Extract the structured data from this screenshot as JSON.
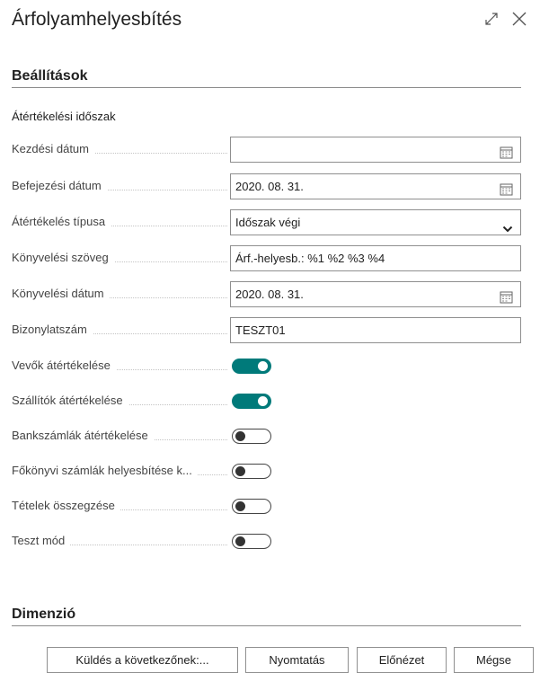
{
  "dialog": {
    "title": "Árfolyamhelyesbítés"
  },
  "sections": {
    "options_title": "Beállítások",
    "group_title": "Átértékelési időszak",
    "dimension_title": "Dimenzió"
  },
  "fields": {
    "start_date_label": "Kezdési dátum",
    "start_date_value": "",
    "end_date_label": "Befejezési dátum",
    "end_date_value": "2020. 08. 31.",
    "reval_type_label": "Átértékelés típusa",
    "reval_type_value": "Időszak végi",
    "posting_text_label": "Könyvelési szöveg",
    "posting_text_value": "Árf.-helyesb.: %1 %2 %3 %4",
    "posting_date_label": "Könyvelési dátum",
    "posting_date_value": "2020. 08. 31.",
    "doc_no_label": "Bizonylatszám",
    "doc_no_value": "TESZT01"
  },
  "toggles": {
    "customers_label": "Vevők átértékelése",
    "customers_on": true,
    "vendors_label": "Szállítók átértékelése",
    "vendors_on": true,
    "banks_label": "Bankszámlák átértékelése",
    "banks_on": false,
    "gl_label": "Főkönyvi számlák helyesbítése k...",
    "gl_on": false,
    "summarize_label": "Tételek összegzése",
    "summarize_on": false,
    "test_label": "Teszt mód",
    "test_on": false
  },
  "buttons": {
    "send_to": "Küldés a következőnek:...",
    "print": "Nyomtatás",
    "preview": "Előnézet",
    "cancel": "Mégse"
  },
  "colors": {
    "accent": "#007a7a"
  },
  "icons": [
    "expand-icon",
    "close-icon",
    "calendar-icon",
    "chevron-down-icon"
  ]
}
